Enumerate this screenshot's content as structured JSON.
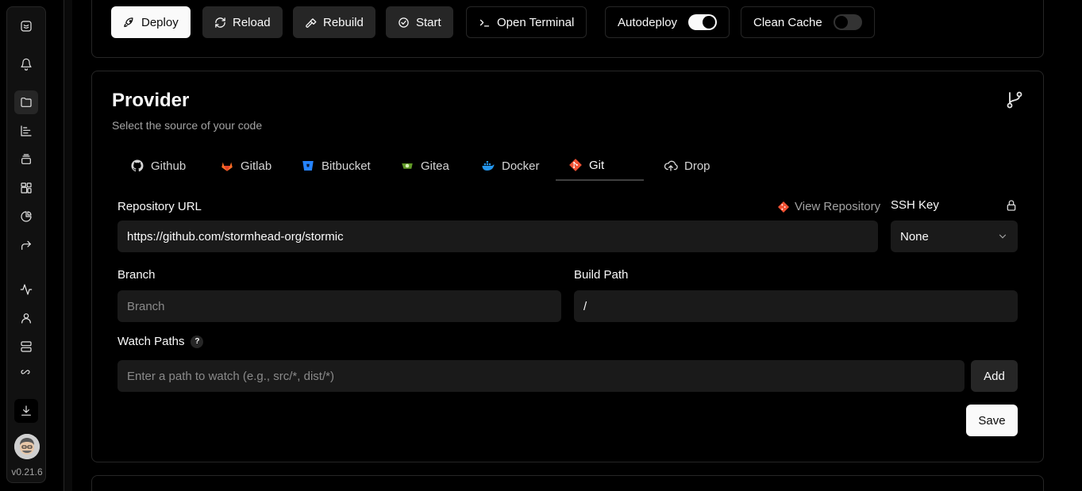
{
  "sidebar": {
    "items": [
      {
        "icon": "logo-icon"
      },
      {
        "icon": "bell-icon"
      },
      {
        "icon": "folder-icon"
      },
      {
        "icon": "chart-icon"
      },
      {
        "icon": "layers-icon"
      },
      {
        "icon": "blocks-icon"
      },
      {
        "icon": "pie-chart-icon"
      },
      {
        "icon": "forward-icon"
      },
      {
        "icon": "activity-icon"
      },
      {
        "icon": "user-icon"
      },
      {
        "icon": "server-icon"
      },
      {
        "icon": "infinity-icon"
      },
      {
        "icon": "download-icon"
      }
    ],
    "version": "v0.21.6"
  },
  "toolbar": {
    "deploy": "Deploy",
    "reload": "Reload",
    "rebuild": "Rebuild",
    "start": "Start",
    "open_terminal": "Open Terminal",
    "autodeploy": "Autodeploy",
    "autodeploy_on": true,
    "clean_cache": "Clean Cache",
    "clean_cache_on": false
  },
  "provider": {
    "title": "Provider",
    "subtitle": "Select the source of your code",
    "tabs": [
      {
        "label": "Github",
        "icon": "github-icon"
      },
      {
        "label": "Gitlab",
        "icon": "gitlab-icon"
      },
      {
        "label": "Bitbucket",
        "icon": "bitbucket-icon"
      },
      {
        "label": "Gitea",
        "icon": "gitea-icon"
      },
      {
        "label": "Docker",
        "icon": "docker-icon"
      },
      {
        "label": "Git",
        "icon": "git-icon",
        "active": true
      },
      {
        "label": "Drop",
        "icon": "upload-cloud-icon"
      }
    ],
    "repo_label": "Repository URL",
    "view_repository": "View Repository",
    "repo_value": "https://github.com/stormhead-org/stormic",
    "ssh_label": "SSH Key",
    "ssh_value": "None",
    "branch_label": "Branch",
    "branch_placeholder": "Branch",
    "build_path_label": "Build Path",
    "build_path_value": "/",
    "watch_label": "Watch Paths",
    "watch_help": "?",
    "watch_placeholder": "Enter a path to watch (e.g., src/*, dist/*)",
    "add_label": "Add",
    "save_label": "Save"
  },
  "colors": {
    "git_orange": "#f05133",
    "gitlab_orange": "#fc6d26",
    "bitbucket_blue": "#2684ff",
    "gitea_green": "#609926",
    "docker_blue": "#2496ed"
  }
}
